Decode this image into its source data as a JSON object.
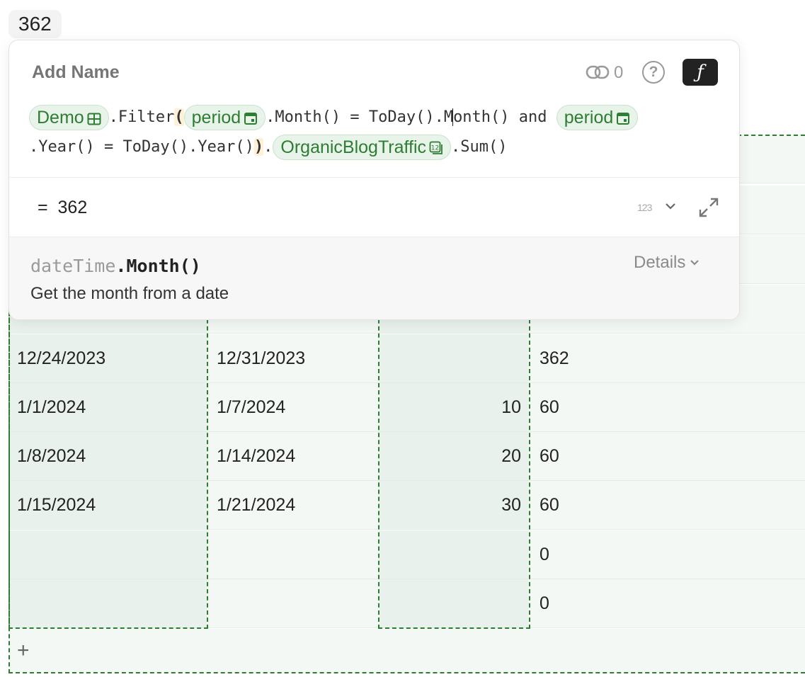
{
  "top_result": "362",
  "popup": {
    "name_placeholder": "Add Name",
    "link_count": "0",
    "help_label": "?",
    "formula_toggle": "ƒ",
    "formula": {
      "table_ref": "Demo",
      "filter": ".Filter",
      "open_paren": "(",
      "period_ref_1": "period",
      "month_expr_a": ".Month() = ToDay().M",
      "month_expr_b": "onth() and ",
      "period_ref_2": "period",
      "year_expr": ".Year() = ToDay().Year()",
      "close_paren": ")",
      "dot": ".",
      "column_ref": "OrganicBlogTraffic",
      "sum": ".Sum()"
    },
    "result_prefix": "=",
    "result_value": "362",
    "type_label": "123",
    "help": {
      "owner": "dateTime",
      "function": ".Month()",
      "details_label": "Details",
      "description": "Get the month from a date"
    }
  },
  "table": {
    "rows": [
      {
        "start": "",
        "end": "",
        "blog": "",
        "total": ""
      },
      {
        "start": "",
        "end": "",
        "blog": "",
        "total": ""
      },
      {
        "start": "",
        "end": "",
        "blog": "",
        "total": ""
      },
      {
        "start": "",
        "end": "",
        "blog": "",
        "total": ""
      },
      {
        "start": "12/24/2023",
        "end": "12/31/2023",
        "blog": "",
        "total": "362"
      },
      {
        "start": "1/1/2024",
        "end": "1/7/2024",
        "blog": "10",
        "total": "60"
      },
      {
        "start": "1/8/2024",
        "end": "1/14/2024",
        "blog": "20",
        "total": "60"
      },
      {
        "start": "1/15/2024",
        "end": "1/21/2024",
        "blog": "30",
        "total": "60"
      },
      {
        "start": "",
        "end": "",
        "blog": "",
        "total": "0"
      },
      {
        "start": "",
        "end": "",
        "blog": "",
        "total": "0"
      }
    ],
    "add_row_label": "+"
  },
  "colors": {
    "accent": "#2e7d32",
    "chip_bg": "#e8f3ea",
    "paren_highlight": "#fff1d6"
  }
}
